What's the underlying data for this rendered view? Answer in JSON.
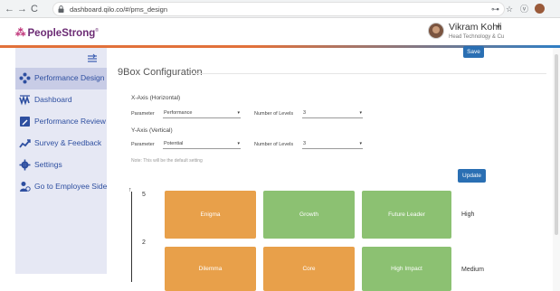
{
  "browser": {
    "back_icon": "←",
    "forward_icon": "→",
    "reload_icon": "C",
    "url": "dashboard.qilo.co/#/pms_design",
    "key_icon": "⊶",
    "star_icon": "☆",
    "extension_icon": "ⓥ"
  },
  "header": {
    "brand": "PeopleStrong",
    "brand_mark": "⁂",
    "brand_trademark": "®",
    "user_name": "Vikram Kohli",
    "user_title": "Head Technology & Cu",
    "caret": "▾"
  },
  "sidebar": {
    "items": [
      {
        "label": "Performance Design",
        "icon": "nodes-icon"
      },
      {
        "label": "Dashboard",
        "icon": "wave-icon"
      },
      {
        "label": "Performance Review",
        "icon": "pencil-icon"
      },
      {
        "label": "Survey & Feedback",
        "icon": "chart-trend-icon"
      },
      {
        "label": "Settings",
        "icon": "gear-icon"
      },
      {
        "label": "Go to Employee Side",
        "icon": "person-icon"
      }
    ],
    "active_index": 0
  },
  "main": {
    "title": "9Box Configuration",
    "save_label": "Save",
    "update_label": "Update",
    "x_axis": {
      "title": "X-Axis (Horizontal)",
      "param_label": "Parameter",
      "param_value": "Performance",
      "levels_label": "Number of Levels",
      "levels_value": "3"
    },
    "y_axis": {
      "title": "Y-Axis (Vertical)",
      "param_label": "Parameter",
      "param_value": "Potential",
      "levels_label": "Number of Levels",
      "levels_value": "3"
    },
    "note": "Note: This will be the default setting",
    "select_caret": "▾"
  },
  "grid": {
    "arrow": "↑",
    "level_top": "5",
    "level_mid": "2",
    "rows": [
      {
        "label": "High",
        "boxes": [
          {
            "name": "Enigma",
            "color": "#e8a04a"
          },
          {
            "name": "Growth",
            "color": "#8cc172"
          },
          {
            "name": "Future Leader",
            "color": "#8cc172"
          }
        ]
      },
      {
        "label": "Medium",
        "boxes": [
          {
            "name": "Dilemma",
            "color": "#e8a04a"
          },
          {
            "name": "Core",
            "color": "#e8a04a"
          },
          {
            "name": "High Impact",
            "color": "#8cc172"
          }
        ]
      }
    ]
  }
}
